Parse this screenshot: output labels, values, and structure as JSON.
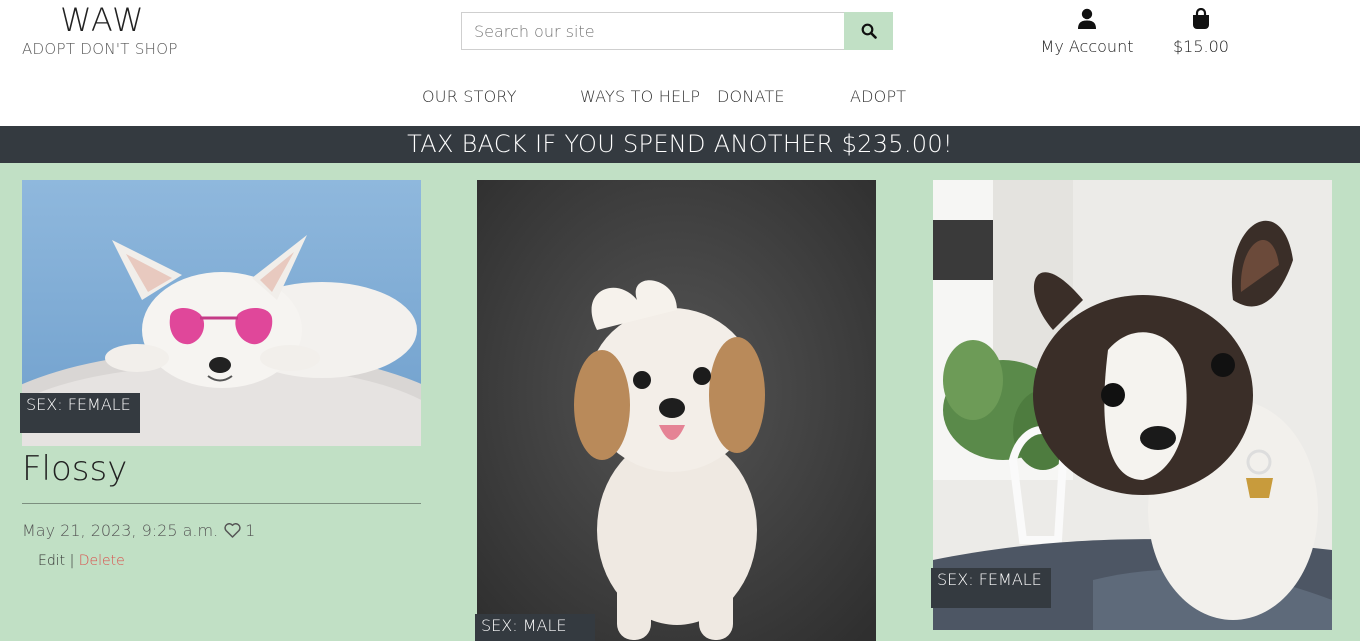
{
  "brand": {
    "title": "WAW",
    "tagline": "ADOPT DON'T SHOP"
  },
  "search": {
    "placeholder": "Search our site",
    "value": "",
    "button_icon": "search-icon"
  },
  "header": {
    "account_label": "My Account",
    "account_icon": "user-icon",
    "bag_total": "$15.00",
    "bag_icon": "shopping-bag-icon"
  },
  "nav": {
    "items": [
      "OUR STORY",
      "WAYS TO HELP",
      "DONATE",
      "ADOPT"
    ]
  },
  "banner": {
    "text": "TAX BACK IF YOU SPEND ANOTHER $235.00!"
  },
  "colors": {
    "accent": "#c1e0c5",
    "dark": "#343a40",
    "delete": "#d9534f"
  },
  "pets": [
    {
      "sex": "SEX: FEMALE",
      "name": "Flossy",
      "date": "May 21, 2023, 9:25 a.m.",
      "likes": "1",
      "edit_label": "Edit",
      "separator": "|",
      "delete_label": "Delete"
    },
    {
      "sex": "SEX: MALE"
    },
    {
      "sex": "SEX: FEMALE"
    }
  ]
}
